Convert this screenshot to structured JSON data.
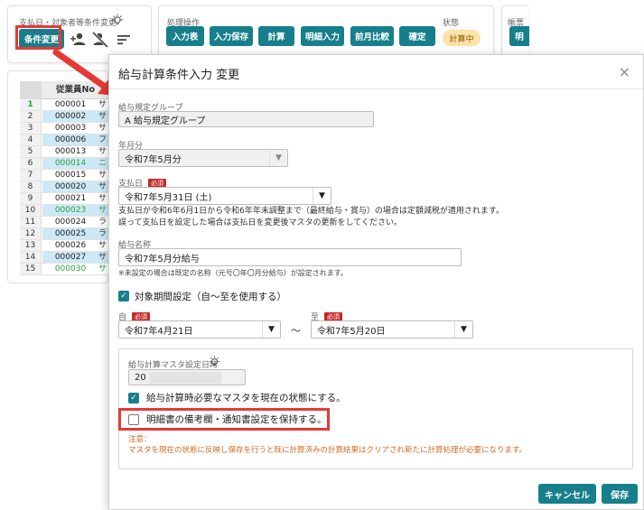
{
  "background": {
    "card1": {
      "title": "支払日・対象者等条件変更",
      "primary_button": "条件変更",
      "icons": [
        "add-person-icon",
        "remove-person-icon",
        "sort-icon",
        "lightbulb-icon"
      ]
    },
    "card2": {
      "title": "処理操作",
      "buttons": [
        "入力表",
        "入力保存",
        "計算",
        "明細入力",
        "前月比較",
        "確定"
      ],
      "status_label": "状態",
      "status_value": "計算中"
    },
    "card3": {
      "title": "帳票",
      "button_partial": "明"
    },
    "grid": {
      "column_header": "従業員No",
      "rows": [
        {
          "n": "1",
          "emp": "000001",
          "ext": "サ",
          "style": "plain"
        },
        {
          "n": "2",
          "emp": "000002",
          "ext": "サ",
          "style": "blue"
        },
        {
          "n": "3",
          "emp": "000003",
          "ext": "サ",
          "style": "plain"
        },
        {
          "n": "4",
          "emp": "000006",
          "ext": "フ",
          "style": "blue"
        },
        {
          "n": "5",
          "emp": "000013",
          "ext": "サ",
          "style": "plain"
        },
        {
          "n": "6",
          "emp": "000014",
          "ext": "ニ",
          "style": "blue-green"
        },
        {
          "n": "7",
          "emp": "000015",
          "ext": "サ",
          "style": "plain"
        },
        {
          "n": "8",
          "emp": "000020",
          "ext": "サ",
          "style": "blue"
        },
        {
          "n": "9",
          "emp": "000021",
          "ext": "サ",
          "style": "plain"
        },
        {
          "n": "10",
          "emp": "000023",
          "ext": "サ",
          "style": "blue-green"
        },
        {
          "n": "11",
          "emp": "000024",
          "ext": "ラ",
          "style": "plain"
        },
        {
          "n": "12",
          "emp": "000025",
          "ext": "ラ",
          "style": "blue"
        },
        {
          "n": "13",
          "emp": "000026",
          "ext": "サ",
          "style": "plain"
        },
        {
          "n": "14",
          "emp": "000027",
          "ext": "サ",
          "style": "blue"
        },
        {
          "n": "15",
          "emp": "000030",
          "ext": "サ",
          "style": "green"
        }
      ]
    }
  },
  "dialog": {
    "title": "給与計算条件入力 変更",
    "close_glyph": "×",
    "salary_group": {
      "label": "給与規定グループ",
      "value": "A 給与規定グループ"
    },
    "year_month": {
      "label": "年月分",
      "value": "令和7年5月分"
    },
    "pay_date": {
      "label": "支払日",
      "required": "必須",
      "value": "令和7年5月31日 (土)",
      "note1": "支払日が令和6年6月1日から令和6年年末調整まで（最終給与・賞与）の場合は定額減税が適用されます。",
      "note2": "誤って支払日を設定した場合は支払日を変更後マスタの更新をしてください。"
    },
    "salary_name": {
      "label": "給与名称",
      "value": "令和7年5月分給与",
      "note": "※未設定の場合は既定の名称（元号〇年〇月分給与）が設定されます。"
    },
    "period_setting": {
      "label": "対象期間設定（自～至を使用する）",
      "checked": true
    },
    "from": {
      "label": "自",
      "required": "必須",
      "value": "令和7年4月21日"
    },
    "to": {
      "label": "至",
      "required": "必須",
      "value": "令和7年5月20日"
    },
    "tilde": "～",
    "arrow_glyph": "▼",
    "master": {
      "label": "給与計算マスタ設定日時",
      "value_visible": "20",
      "check_current": {
        "label": "給与計算時必要なマスタを現在の状態にする。",
        "checked": true
      },
      "check_keep": {
        "label": "明細書の備考欄・通知書設定を保持する。",
        "checked": false
      },
      "caution_title": "注意：",
      "caution_text": "マスタを現在の状態に反映し保存を行うと既に計算済みの計算結果はクリアされ新たに計算処理が必要になります。"
    },
    "buttons": {
      "cancel": "キャンセル",
      "save": "保存"
    }
  },
  "colors": {
    "teal": "#177f8c",
    "highlight_red": "#e53935",
    "required_red": "#c62828",
    "warn_orange": "#d2691e",
    "status_bg": "#fde3a8",
    "row_blue": "#cde8f6"
  }
}
